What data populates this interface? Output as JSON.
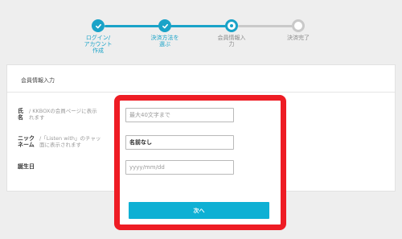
{
  "stepper": {
    "steps": [
      {
        "label": "ログイン/\nアカウント\n作成",
        "state": "done",
        "icon": "check-icon"
      },
      {
        "label": "決済方法を\n選ぶ",
        "state": "done",
        "icon": "check-icon"
      },
      {
        "label": "会員情報入\n力",
        "state": "current",
        "icon": "current-step-icon"
      },
      {
        "label": "決済完了",
        "state": "todo",
        "icon": "pending-step-icon"
      }
    ],
    "colors": {
      "active": "#1aa3c8",
      "inactive": "#c9c9c9"
    }
  },
  "form": {
    "title": "会員情報入力",
    "fields": [
      {
        "label": "氏\n名",
        "note": "/ KKBOXの会員ページに表示\nれます",
        "placeholder": "最大40文字まで",
        "value": ""
      },
      {
        "label": "ニック\nネーム",
        "note": "/「Listen with」のチャッ\n面に表示されます",
        "placeholder": "",
        "value": "名前なし"
      },
      {
        "label": "誕生日",
        "note": "",
        "placeholder": "yyyy/mm/dd",
        "value": ""
      }
    ],
    "submit_label": "次へ"
  },
  "colors": {
    "accent": "#1aa3c8",
    "button": "#0eb0d4",
    "highlight": "#ee1c24"
  }
}
